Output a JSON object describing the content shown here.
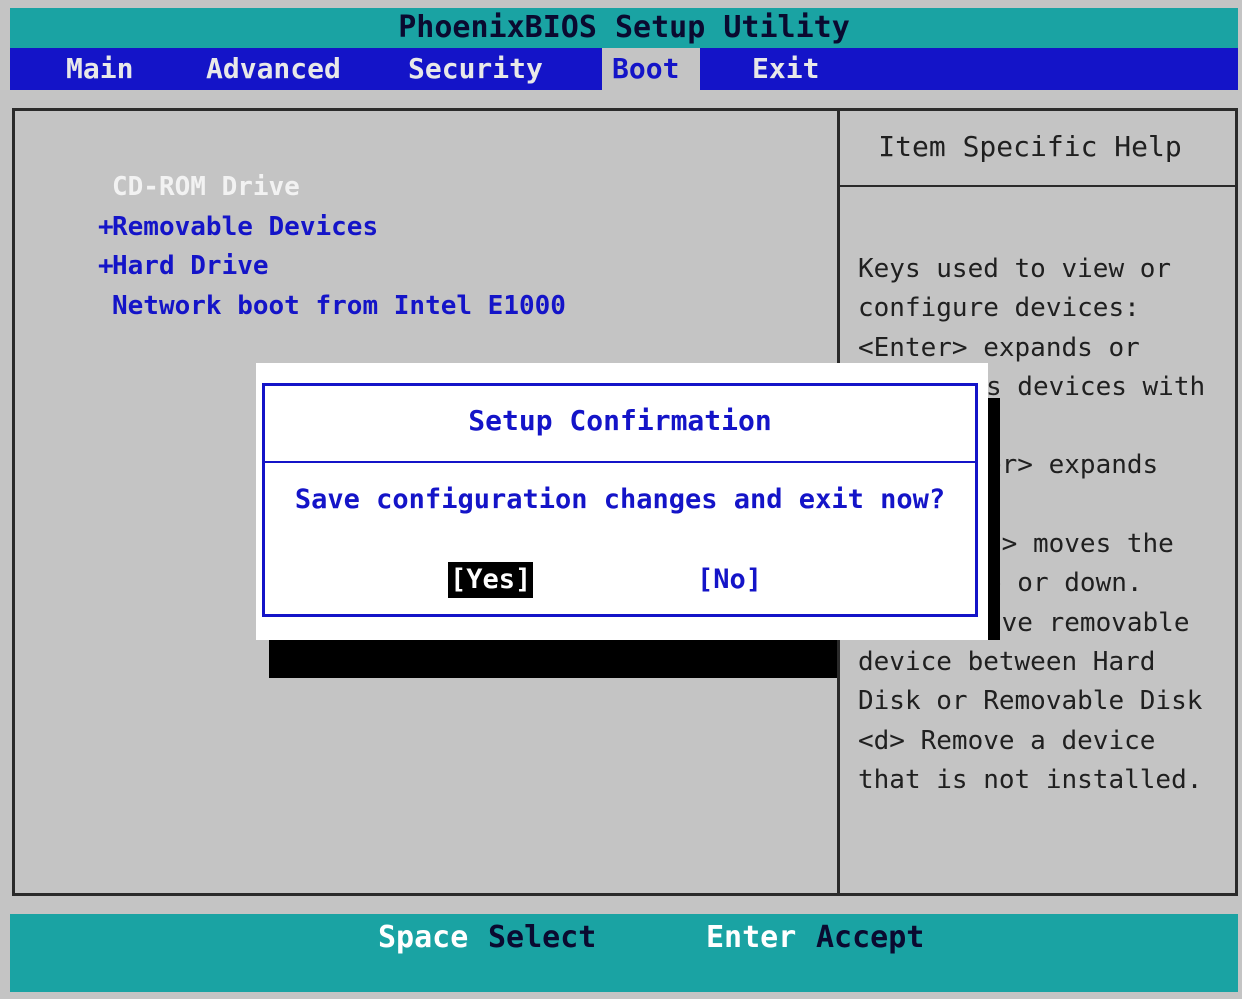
{
  "title": "PhoenixBIOS Setup Utility",
  "menu": {
    "items": [
      {
        "label": "Main"
      },
      {
        "label": "Advanced"
      },
      {
        "label": "Security"
      },
      {
        "label": "Boot"
      },
      {
        "label": "Exit"
      }
    ],
    "selected": "Boot"
  },
  "boot_order": [
    {
      "prefix": "",
      "label": "CD-ROM Drive"
    },
    {
      "prefix": "+",
      "label": "Removable Devices"
    },
    {
      "prefix": "+",
      "label": "Hard Drive"
    },
    {
      "prefix": "",
      "label": "Network boot from Intel E1000"
    }
  ],
  "help": {
    "title": "Item Specific Help",
    "lines": [
      "Keys used to view or",
      "configure devices:",
      "<Enter> expands or",
      "s devices with",
      "",
      "er> expands",
      "",
      "-> moves the",
      "p or down.",
      "ove removable",
      "device between Hard",
      "Disk or Removable Disk",
      "<d> Remove a device",
      "that is not installed."
    ]
  },
  "dialog": {
    "title": "Setup Confirmation",
    "message": "Save configuration changes and exit now?",
    "yes_label": "[Yes]",
    "no_label": "[No]",
    "selected": "Yes"
  },
  "footer": {
    "keys": [
      {
        "key": "Space",
        "desc": "Select"
      },
      {
        "key": "Enter",
        "desc": "Accept"
      }
    ]
  },
  "colors": {
    "title_bg": "#1aa3a3",
    "menu_bg": "#1414c8",
    "panel_bg": "#c4c4c4",
    "accent_text": "#1414c8"
  }
}
